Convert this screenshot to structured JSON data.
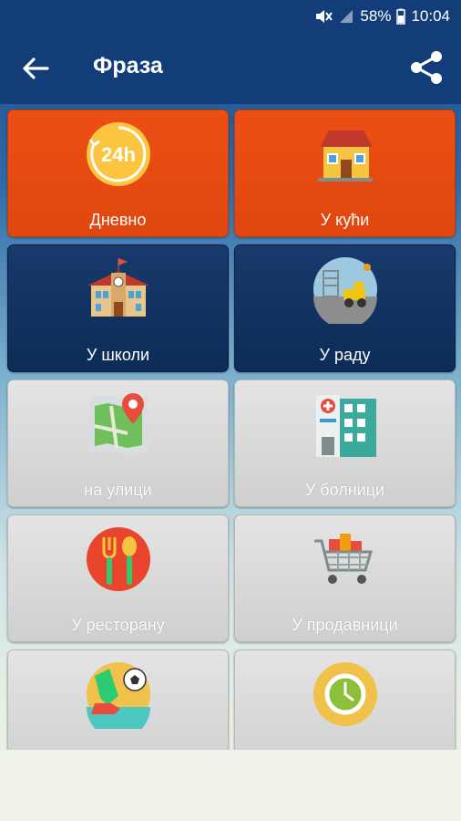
{
  "status": {
    "battery_pct": "58%",
    "time": "10:04",
    "icons": [
      "mute-icon",
      "signal-icon",
      "battery-icon"
    ]
  },
  "appbar": {
    "title": "Фраза",
    "back_icon": "arrow-left-icon",
    "share_icon": "share-icon"
  },
  "tiles": [
    {
      "label": "Дневно",
      "icon": "24h-icon",
      "color": "#e84c12"
    },
    {
      "label": "У кући",
      "icon": "house-icon",
      "color": "#e84c12"
    },
    {
      "label": "У школи",
      "icon": "school-icon",
      "color": "#11335f"
    },
    {
      "label": "У раду",
      "icon": "construction-icon",
      "color": "#11335f"
    },
    {
      "label": "на улици",
      "icon": "map-pin-icon",
      "color": "#d9d9d9"
    },
    {
      "label": "У болници",
      "icon": "hospital-icon",
      "color": "#d9d9d9"
    },
    {
      "label": "У ресторану",
      "icon": "fork-spoon-icon",
      "color": "#d9d9d9"
    },
    {
      "label": "У продавници",
      "icon": "shopping-cart-icon",
      "color": "#d9d9d9"
    },
    {
      "label": "",
      "icon": "soccer-icon",
      "color": "#d9d9d9"
    },
    {
      "label": "",
      "icon": "clock-icon",
      "color": "#d9d9d9"
    }
  ]
}
